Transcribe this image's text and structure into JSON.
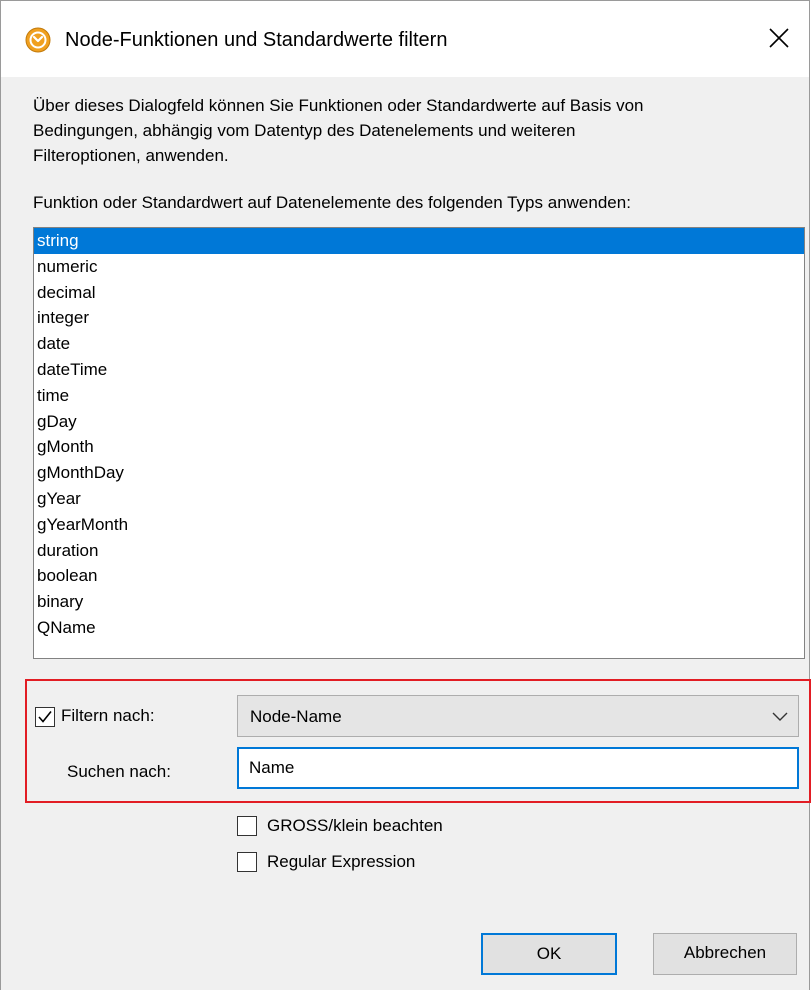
{
  "window": {
    "title": "Node-Funktionen und Standardwerte filtern",
    "app_icon": "altova-mapforce-icon",
    "close_icon": "close-icon"
  },
  "description": "Über dieses Dialogfeld können Sie Funktionen oder Standardwerte auf Basis von\nBedingungen, abhängig vom Datentyp des Datenelements und weiteren\nFilteroptionen, anwenden.",
  "type_list": {
    "label": "Funktion oder Standardwert auf Datenelemente des folgenden Typs anwenden:",
    "items": [
      "string",
      "numeric",
      "decimal",
      "integer",
      "date",
      "dateTime",
      "time",
      "gDay",
      "gMonth",
      "gMonthDay",
      "gYear",
      "gYearMonth",
      "duration",
      "boolean",
      "binary",
      "QName"
    ],
    "selected": "string"
  },
  "filter": {
    "enabled": true,
    "label": "Filtern nach:",
    "dropdown_value": "Node-Name",
    "search_label": "Suchen nach:",
    "search_value": "Name"
  },
  "options": {
    "case_sensitive_label": "GROSS/klein beachten",
    "case_sensitive": false,
    "regex_label": "Regular Expression",
    "regex": false
  },
  "buttons": {
    "ok": "OK",
    "cancel": "Abbrechen"
  },
  "colors": {
    "selection": "#0078d7",
    "highlight_border": "#e21d24"
  }
}
